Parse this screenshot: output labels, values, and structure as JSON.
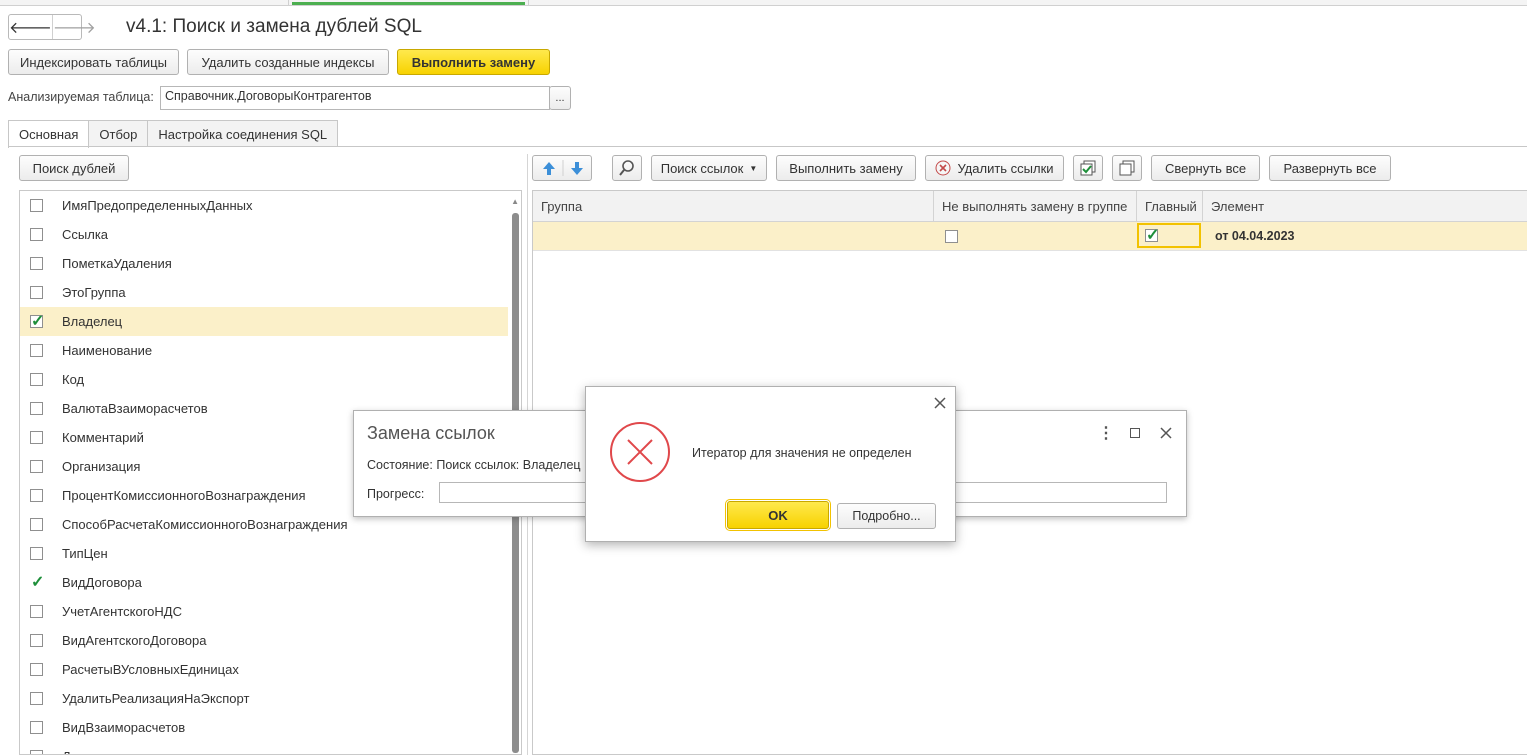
{
  "window": {
    "title": "v4.1: Поиск и замена дублей SQL"
  },
  "nav": {
    "back": "🡐",
    "forward": "🡒"
  },
  "toolbar": {
    "index_tables": "Индексировать таблицы",
    "delete_indexes": "Удалить созданные индексы",
    "execute_replace": "Выполнить замену"
  },
  "table_field": {
    "label": "Анализируемая таблица:",
    "value": "Справочник.ДоговорыКонтрагентов",
    "select_btn": "..."
  },
  "tabs": [
    "Основная",
    "Отбор",
    "Настройка соединения SQL"
  ],
  "left": {
    "search_button": "Поиск дублей",
    "fields": [
      {
        "name": "ИмяПредопределенныхДанных",
        "checked": false
      },
      {
        "name": "Ссылка",
        "checked": false
      },
      {
        "name": "ПометкаУдаления",
        "checked": false
      },
      {
        "name": "ЭтоГруппа",
        "checked": false
      },
      {
        "name": "Владелец",
        "checked": true,
        "selected": true
      },
      {
        "name": "Наименование",
        "checked": false
      },
      {
        "name": "Код",
        "checked": false
      },
      {
        "name": "ВалютаВзаиморасчетов",
        "checked": false
      },
      {
        "name": "Комментарий",
        "checked": false
      },
      {
        "name": "Организация",
        "checked": false
      },
      {
        "name": "ПроцентКомиссионногоВознаграждения",
        "checked": false
      },
      {
        "name": "СпособРасчетаКомиссионногоВознаграждения",
        "checked": false
      },
      {
        "name": "ТипЦен",
        "checked": false
      },
      {
        "name": "ВидДоговора",
        "checked": true,
        "plain": true
      },
      {
        "name": "УчетАгентскогоНДС",
        "checked": false
      },
      {
        "name": "ВидАгентскогоДоговора",
        "checked": false
      },
      {
        "name": "РасчетыВУсловныхЕдиницах",
        "checked": false
      },
      {
        "name": "УдалитьРеализацияНаЭкспорт",
        "checked": false
      },
      {
        "name": "ВидВзаиморасчетов",
        "checked": false
      },
      {
        "name": "Дата",
        "checked": false
      }
    ]
  },
  "right_toolbar": {
    "find_links": "Поиск ссылок",
    "execute_replace": "Выполнить замену",
    "delete_links": "Удалить ссылки",
    "collapse_all": "Свернуть все",
    "expand_all": "Развернуть все"
  },
  "grid": {
    "columns": [
      "Группа",
      "Не выполнять замену в группе",
      "Главный",
      "Элемент"
    ],
    "rows": [
      {
        "group": "",
        "no_replace": false,
        "main": true,
        "element": "от 04.04.2023"
      }
    ]
  },
  "replace_dialog": {
    "title": "Замена ссылок",
    "status_label": "Состояние:",
    "status_value": "Поиск ссылок: Владелец",
    "progress_label": "Прогресс:"
  },
  "error_dialog": {
    "message": "Итератор для значения не определен",
    "ok": "OK",
    "details": "Подробно..."
  },
  "colors": {
    "accent_yellow": "#f7d200",
    "selection": "#fbf0c9",
    "error_red": "#e0484b",
    "check_green": "#1e8f3a"
  }
}
